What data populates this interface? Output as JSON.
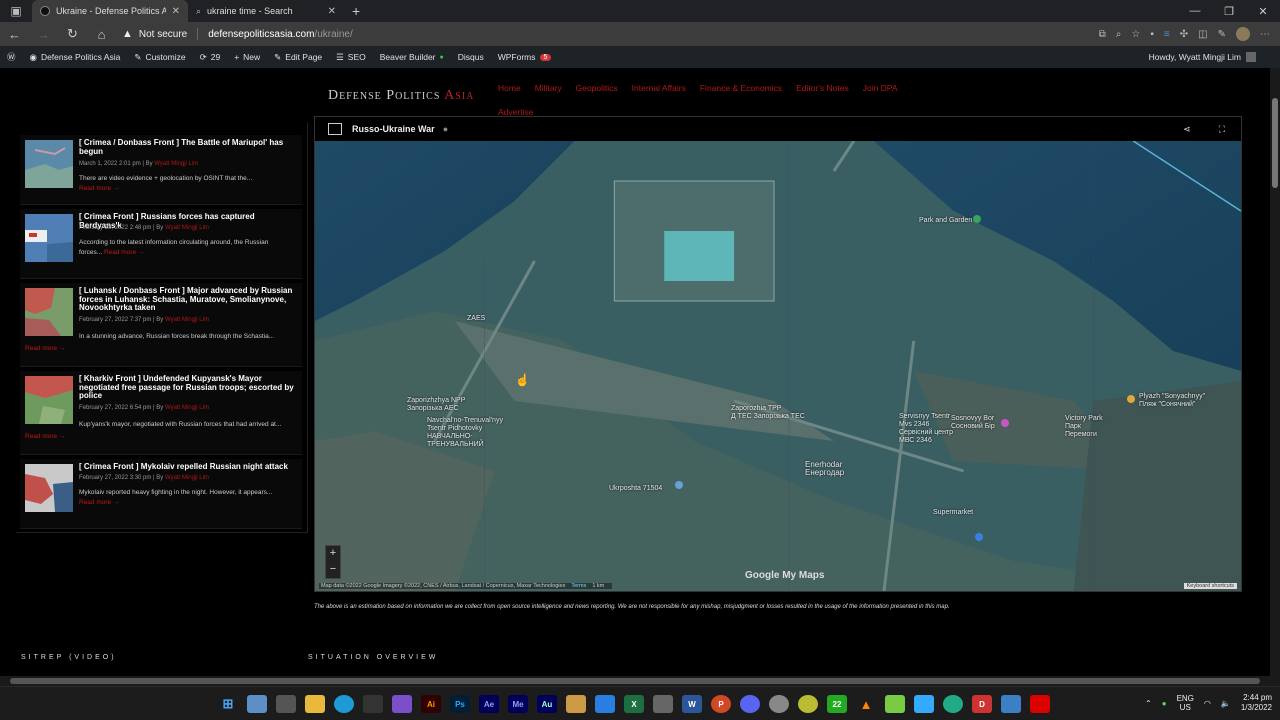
{
  "browser": {
    "tabs": [
      {
        "title": "Ukraine - Defense Politics Asia",
        "active": true
      },
      {
        "title": "ukraine time - Search",
        "active": false
      }
    ],
    "security_label": "Not secure",
    "url_host": "defensepoliticsasia.com",
    "url_path": "/ukraine/"
  },
  "wpbar": {
    "site_name": "Defense Politics Asia",
    "customize": "Customize",
    "updates": "29",
    "new": "New",
    "edit_page": "Edit Page",
    "seo": "SEO",
    "beaver": "Beaver Builder",
    "disqus": "Disqus",
    "wpforms": "WPForms",
    "wpforms_badge": "5",
    "howdy": "Howdy, Wyatt Mingji Lim"
  },
  "site": {
    "brand_main": "Defense Politics",
    "brand_accent": "Asia",
    "nav": [
      "Home",
      "Military",
      "Geopolitics",
      "Internal Affairs",
      "Finance & Economics",
      "Editor's Notes",
      "Join DPA",
      "Advertise"
    ]
  },
  "posts": [
    {
      "title": "[ Crimea / Donbass Front ] The Battle of Mariupol' has begun",
      "date": "March 1, 2022 2:01 pm | By ",
      "author": "Wyatt Mingji Lim",
      "excerpt": "There are video evidence + geolocation by OSINT that the...",
      "more": "Read more →"
    },
    {
      "title": "[ Crimea Front ] Russians forces has captured Berdyans'k",
      "date": "February 28, 2022 2:48 pm | By ",
      "author": "Wyatt Mingji Lim",
      "excerpt": "According to the latest information circulating around, the Russian",
      "excerpt2": "forces...",
      "more": "Read more →"
    },
    {
      "title": "[ Luhansk / Donbass Front ] Major advanced by Russian forces in Luhansk: Schastia, Muratove, Smolianynove, Novookhtyrka taken",
      "date": "February 27, 2022 7:37 pm | By ",
      "author": "Wyatt Mingji Lim",
      "excerpt": "In a stunning advance, Russian forces break through the Schastia...",
      "more": "Read more →"
    },
    {
      "title": "[ Kharkiv Front ] Undefended Kupyansk's Mayor negotiated free passage for Russian troops; escorted by police",
      "date": "February 27, 2022 6:54 pm | By ",
      "author": "Wyatt Mingji Lim",
      "excerpt": "Kup'yans'k mayor, negotiated with Russian forces that had arrived at...",
      "more": "Read more →"
    },
    {
      "title": "[ Crimea Front ] Mykolaiv repelled Russian night attack",
      "date": "February 27, 2022 3:30 pm | By ",
      "author": "Wyatt Mingji Lim",
      "excerpt": "Mykolaiv reported heavy fighting in the night. However, it appears...",
      "more": "Read more →"
    }
  ],
  "map": {
    "title": "Russo-Ukraine War",
    "labels": {
      "zaes": "ZAES",
      "npp": "Zaporizhzhya NPP",
      "npp_ua": "Запорізька АЕС",
      "navchal": "Navchal'no-Trenuval'nyy",
      "pidhotovky": "Tsentr Pidhotovky",
      "navchal_ua": "НАВЧАЛЬНО-",
      "navchal_ua2": "ТРЕНУВАЛЬНИЙ",
      "tpp": "Zaporozhia TPP",
      "tpp_ua": "Д ТЕС Запорізька ТЕС",
      "enerhodar": "Enerhodar",
      "enerhodar_ua": "Енергодар",
      "ukrposhta": "Ukrposhta 71504",
      "servisnyy": "Servisnyy Tsentr",
      "servisnyy2": "Mvs 2346",
      "servisnyy_ua": "Сервісний центр",
      "servisnyy_ua2": "МВС 2346",
      "sosnovyy": "Sosnovyy Bor",
      "sosnovyy_ua": "Сосновий Бір",
      "victory": "Victory Park",
      "victory_ua": "Парк",
      "victory_ua2": "Перемоги",
      "plyazh": "Plyazh \"Sonyachnyy\"",
      "plyazh_ua": "Пляж \"Сонячний\"",
      "park": "Park and Garden",
      "supermarket": "Supermarket"
    },
    "zoom_in": "+",
    "zoom_out": "−",
    "attribution": "Map data ©2022 Google Imagery ©2022, CNES / Airbus, Landsat / Copernicus, Maxar Technologies",
    "terms": "Terms",
    "scale": "1 km",
    "logo": "Google My Maps",
    "keyboard": "Keyboard shortcuts"
  },
  "disclaimer": "The above is an estimation based on information we are collect from open source intelligence and news reporting. We are not responsible for any mishap, misjudgment or losses resulted in the usage of the information presented in this map.",
  "sections": {
    "left": "SITREP (VIDEO)",
    "right": "SITUATION OVERVIEW"
  },
  "taskbar": {
    "lang": "ENG",
    "region": "US",
    "time": "2:44 pm",
    "date": "1/3/2022"
  }
}
